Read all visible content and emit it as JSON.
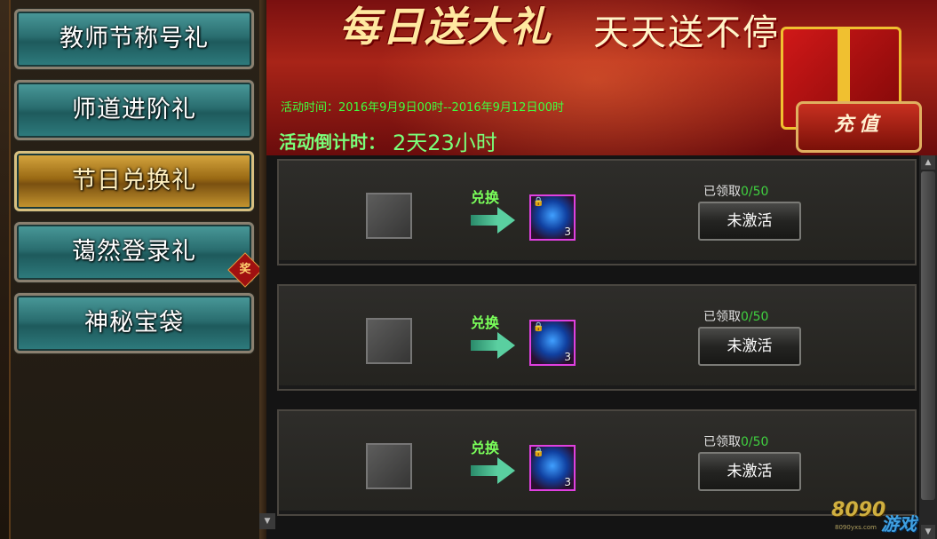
{
  "sidebar": {
    "items": [
      {
        "label": "教师节称号礼",
        "active": false
      },
      {
        "label": "师道进阶礼",
        "active": false
      },
      {
        "label": "节日兑换礼",
        "active": true
      },
      {
        "label": "蔼然登录礼",
        "active": false
      },
      {
        "label": "神秘宝袋",
        "active": false
      }
    ],
    "badge_text": "奖"
  },
  "banner": {
    "title": "每日送大礼",
    "subtitle": "天天送不停",
    "event_time": "活动时间：2016年9月9日00时--2016年9月12日00时",
    "countdown_label": "活动倒计时：",
    "countdown_value": "2天23小时",
    "recharge_label": "充值"
  },
  "rows": [
    {
      "exchange_label": "兑换",
      "reward_qty": "3",
      "claimed_label": "已领取",
      "claimed_count": "0/50",
      "status_label": "未激活"
    },
    {
      "exchange_label": "兑换",
      "reward_qty": "3",
      "claimed_label": "已领取",
      "claimed_count": "0/50",
      "status_label": "未激活"
    },
    {
      "exchange_label": "兑换",
      "reward_qty": "3",
      "claimed_label": "已领取",
      "claimed_count": "0/50",
      "status_label": "未激活"
    }
  ],
  "scrollbar": {
    "up_icon": "▲",
    "down_icon": "▼",
    "left_icon": "▼"
  },
  "watermark": {
    "brand": "8090",
    "game": "游戏",
    "url": "8090yxs.com"
  },
  "colors": {
    "accent_green": "#40ff40",
    "teal_button": "#2a6e70",
    "active_gold": "#c89830"
  }
}
